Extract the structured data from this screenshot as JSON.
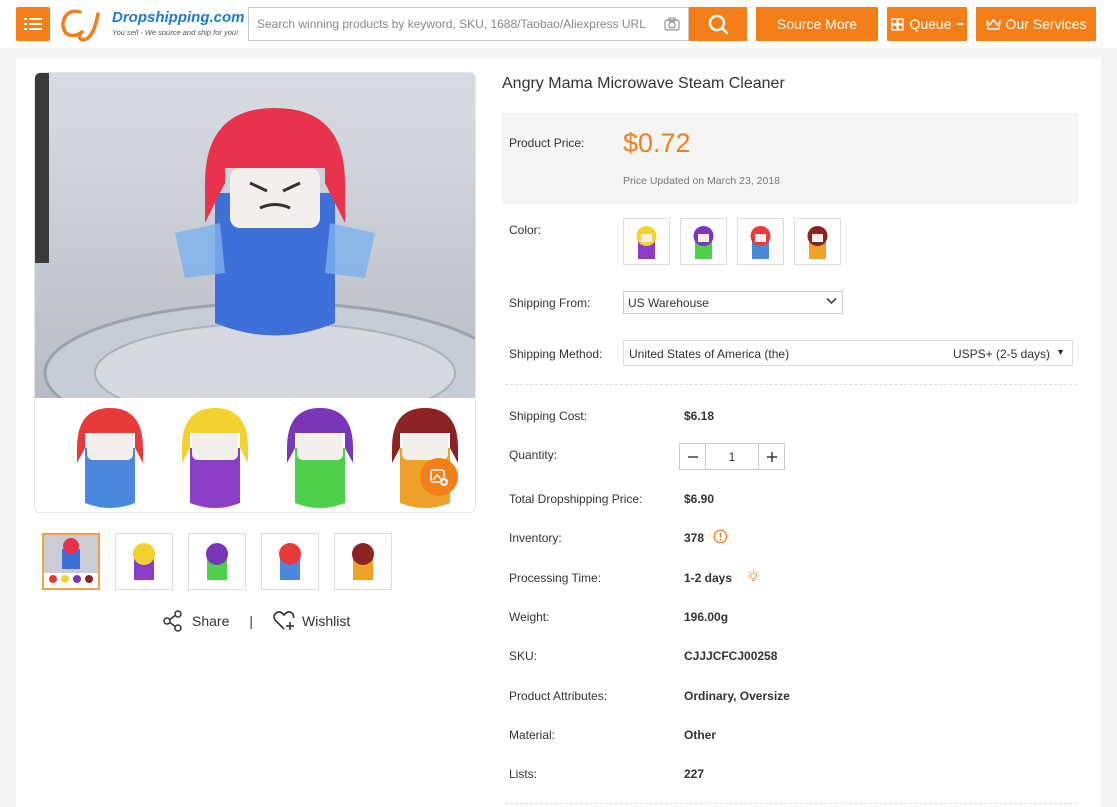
{
  "header": {
    "logo_brand": "Dropshipping.com",
    "logo_tagline": "You sell - We source and ship for you!",
    "search_placeholder": "Search winning products by keyword, SKU, 1688/Taobao/Aliexpress URL",
    "source_more_label": "Source More",
    "queue_label": "Queue",
    "services_label": "Our Services"
  },
  "product": {
    "title": "Angry Mama Microwave Steam Cleaner",
    "price_label": "Product Price:",
    "price": "$0.72",
    "price_updated": "Price Updated on March 23, 2018",
    "color_label": "Color:",
    "colors": [
      "yellow-purple",
      "purple-green",
      "red-blue",
      "maroon-orange"
    ],
    "shipping_from_label": "Shipping From:",
    "shipping_from": "US Warehouse",
    "shipping_method_label": "Shipping Method:",
    "shipping_country": "United States of America (the)",
    "shipping_method": "USPS+ (2-5 days)",
    "shipping_cost_label": "Shipping Cost:",
    "shipping_cost": "$6.18",
    "quantity_label": "Quantity:",
    "quantity": "1",
    "total_label": "Total Dropshipping Price:",
    "total": "$6.90",
    "inventory_label": "Inventory:",
    "inventory": "378",
    "processing_label": "Processing Time:",
    "processing": "1-2 days",
    "weight_label": "Weight:",
    "weight": "196.00g",
    "sku_label": "SKU:",
    "sku": "CJJJCFCJ00258",
    "attributes_label": "Product Attributes:",
    "attributes": "Ordinary, Oversize",
    "material_label": "Material:",
    "material": "Other",
    "lists_label": "Lists:",
    "lists": "227"
  },
  "gallery": {
    "share_label": "Share",
    "separator": "|",
    "wishlist_label": "Wishlist"
  },
  "colors": {
    "accent": "#f47f18"
  }
}
